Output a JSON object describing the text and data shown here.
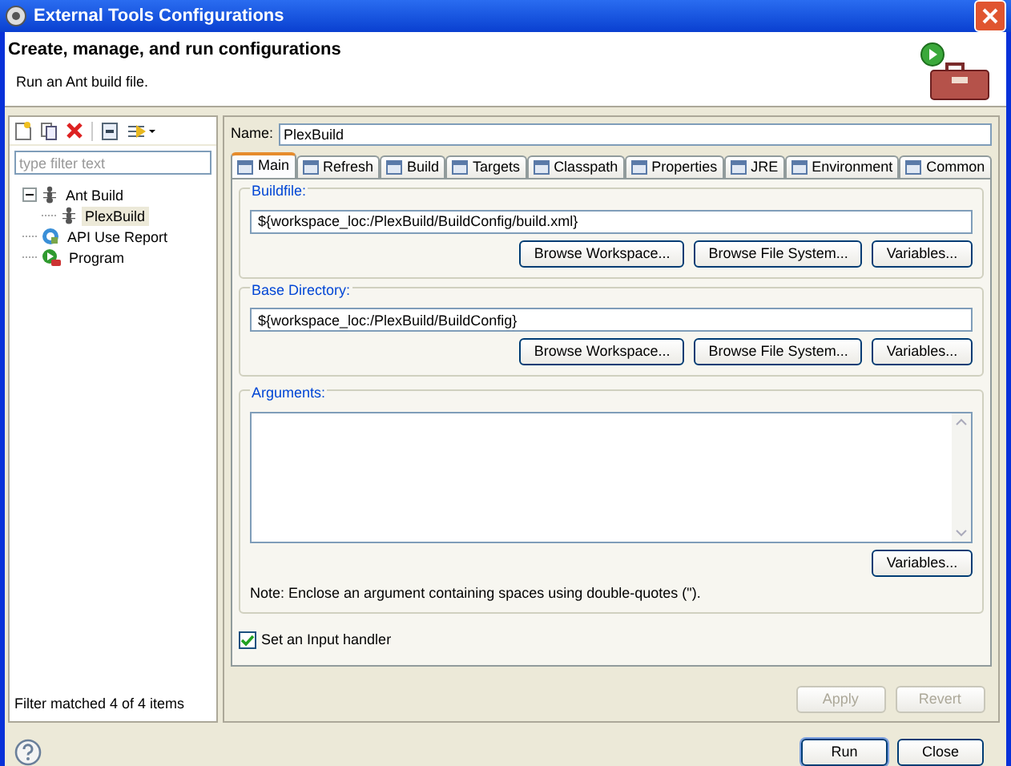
{
  "window": {
    "title": "External Tools Configurations"
  },
  "header": {
    "title": "Create, manage, and run configurations",
    "message": "Run an Ant build file."
  },
  "filter": {
    "placeholder": "type filter text"
  },
  "tree": [
    {
      "label": "Ant Build",
      "kind": "ant",
      "expanded": true,
      "selected": false,
      "children": [
        {
          "label": "PlexBuild",
          "kind": "ant",
          "selected": true
        }
      ]
    },
    {
      "label": "API Use Report",
      "kind": "report",
      "selected": false
    },
    {
      "label": "Program",
      "kind": "program",
      "selected": false
    }
  ],
  "filter_status": "Filter matched 4 of 4 items",
  "name": {
    "label": "Name:",
    "value": "PlexBuild"
  },
  "tabs": [
    {
      "label": "Main",
      "selected": true
    },
    {
      "label": "Refresh",
      "selected": false
    },
    {
      "label": "Build",
      "selected": false
    },
    {
      "label": "Targets",
      "selected": false
    },
    {
      "label": "Classpath",
      "selected": false
    },
    {
      "label": "Properties",
      "selected": false
    },
    {
      "label": "JRE",
      "selected": false
    },
    {
      "label": "Environment",
      "selected": false
    },
    {
      "label": "Common",
      "selected": false
    }
  ],
  "groups": [
    {
      "label": "Buildfile:",
      "value": "${workspace_loc:/PlexBuild/BuildConfig/build.xml}",
      "buttons": [
        "Browse Workspace...",
        "Browse File System...",
        "Variables..."
      ]
    },
    {
      "label": "Base Directory:",
      "value": "${workspace_loc:/PlexBuild/BuildConfig}",
      "buttons": [
        "Browse Workspace...",
        "Browse File System...",
        "Variables..."
      ]
    }
  ],
  "arguments": {
    "label": "Arguments:",
    "button": "Variables...",
    "note": "Note: Enclose an argument containing spaces using double-quotes (\")."
  },
  "input_handler": {
    "label": "Set an Input handler",
    "checked": true
  },
  "actions": [
    {
      "label": "Apply",
      "disabled": true
    },
    {
      "label": "Revert",
      "disabled": true
    }
  ],
  "buttons": [
    {
      "label": "Run",
      "default": true
    },
    {
      "label": "Close",
      "default": false
    }
  ]
}
